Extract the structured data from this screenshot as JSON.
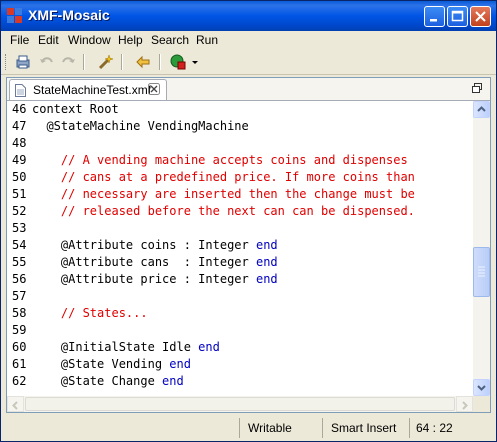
{
  "window": {
    "title": "XMF-Mosaic"
  },
  "menu": {
    "items": [
      "File",
      "Edit",
      "Window",
      "Help",
      "Search",
      "Run"
    ]
  },
  "toolbar": {
    "icons": [
      "print-icon",
      "undo-icon",
      "redo-icon",
      "wand-icon",
      "back-arrow-icon",
      "run-stop-icon",
      "dropdown-icon"
    ]
  },
  "editor": {
    "tab_label": "StateMachineTest.xmf",
    "lines": [
      {
        "num": "46",
        "parts": [
          {
            "t": "kw",
            "s": "context Root"
          }
        ]
      },
      {
        "num": "47",
        "parts": [
          {
            "t": "kw",
            "s": "  @StateMachine VendingMachine"
          }
        ]
      },
      {
        "num": "48",
        "parts": [
          {
            "t": "kw",
            "s": ""
          }
        ]
      },
      {
        "num": "49",
        "parts": [
          {
            "t": "comment",
            "s": "    // A vending machine accepts coins and dispenses"
          }
        ]
      },
      {
        "num": "50",
        "parts": [
          {
            "t": "comment",
            "s": "    // cans at a predefined price. If more coins than"
          }
        ]
      },
      {
        "num": "51",
        "parts": [
          {
            "t": "comment",
            "s": "    // necessary are inserted then the change must be"
          }
        ]
      },
      {
        "num": "52",
        "parts": [
          {
            "t": "comment",
            "s": "    // released before the next can can be dispensed."
          }
        ]
      },
      {
        "num": "53",
        "parts": [
          {
            "t": "kw",
            "s": ""
          }
        ]
      },
      {
        "num": "54",
        "parts": [
          {
            "t": "kw",
            "s": "    @Attribute coins : Integer "
          },
          {
            "t": "keyword",
            "s": "end"
          }
        ]
      },
      {
        "num": "55",
        "parts": [
          {
            "t": "kw",
            "s": "    @Attribute cans  : Integer "
          },
          {
            "t": "keyword",
            "s": "end"
          }
        ]
      },
      {
        "num": "56",
        "parts": [
          {
            "t": "kw",
            "s": "    @Attribute price : Integer "
          },
          {
            "t": "keyword",
            "s": "end"
          }
        ]
      },
      {
        "num": "57",
        "parts": [
          {
            "t": "kw",
            "s": ""
          }
        ]
      },
      {
        "num": "58",
        "parts": [
          {
            "t": "comment",
            "s": "    // States..."
          }
        ]
      },
      {
        "num": "59",
        "parts": [
          {
            "t": "kw",
            "s": ""
          }
        ]
      },
      {
        "num": "60",
        "parts": [
          {
            "t": "kw",
            "s": "    @InitialState Idle "
          },
          {
            "t": "keyword",
            "s": "end"
          }
        ]
      },
      {
        "num": "61",
        "parts": [
          {
            "t": "kw",
            "s": "    @State Vending "
          },
          {
            "t": "keyword",
            "s": "end"
          }
        ]
      },
      {
        "num": "62",
        "parts": [
          {
            "t": "kw",
            "s": "    @State Change "
          },
          {
            "t": "keyword",
            "s": "end"
          }
        ]
      }
    ]
  },
  "status": {
    "mode": "Writable",
    "insert": "Smart Insert",
    "position": "64 : 22"
  },
  "colors": {
    "titlebar": "#0055e5",
    "comment": "#e00000",
    "keyword": "#0000c0"
  }
}
